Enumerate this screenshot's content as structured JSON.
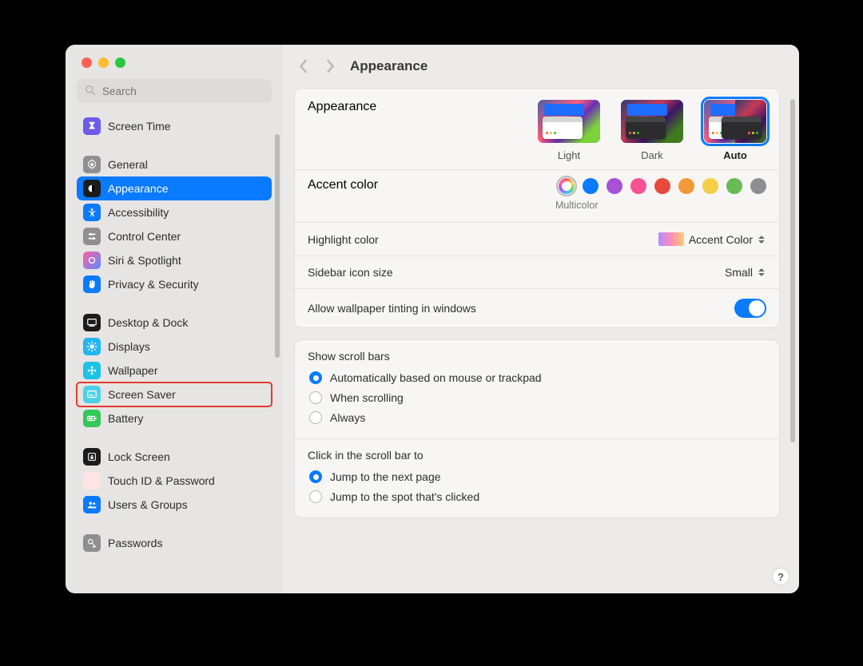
{
  "page_title": "Appearance",
  "search": {
    "placeholder": "Search"
  },
  "sidebar": {
    "items": [
      {
        "label": "Screen Time",
        "icon": "screentime"
      },
      {
        "label": "General",
        "icon": "general"
      },
      {
        "label": "Appearance",
        "icon": "appearance",
        "selected": true
      },
      {
        "label": "Accessibility",
        "icon": "accessibility"
      },
      {
        "label": "Control Center",
        "icon": "controlcenter"
      },
      {
        "label": "Siri & Spotlight",
        "icon": "siri"
      },
      {
        "label": "Privacy & Security",
        "icon": "privacy"
      },
      {
        "label": "Desktop & Dock",
        "icon": "desktop"
      },
      {
        "label": "Displays",
        "icon": "displays"
      },
      {
        "label": "Wallpaper",
        "icon": "wallpaper"
      },
      {
        "label": "Screen Saver",
        "icon": "screensaver",
        "highlighted": true
      },
      {
        "label": "Battery",
        "icon": "battery"
      },
      {
        "label": "Lock Screen",
        "icon": "lockscreen"
      },
      {
        "label": "Touch ID & Password",
        "icon": "touchid"
      },
      {
        "label": "Users & Groups",
        "icon": "users"
      },
      {
        "label": "Passwords",
        "icon": "passwords"
      }
    ]
  },
  "appearance": {
    "label": "Appearance",
    "options": {
      "light": "Light",
      "dark": "Dark",
      "auto": "Auto"
    },
    "selected": "Auto"
  },
  "accent": {
    "label": "Accent color",
    "multicolor_label": "Multicolor",
    "colors": [
      "multicolor",
      "#0a7aff",
      "#a751d8",
      "#f55193",
      "#e8493b",
      "#f19a37",
      "#f6cd46",
      "#68bb55",
      "#8e8e93"
    ],
    "selected": "multicolor"
  },
  "highlight": {
    "label": "Highlight color",
    "value": "Accent Color"
  },
  "sidebar_icon": {
    "label": "Sidebar icon size",
    "value": "Small"
  },
  "tinting": {
    "label": "Allow wallpaper tinting in windows",
    "on": true
  },
  "scrollbars": {
    "title": "Show scroll bars",
    "options": [
      "Automatically based on mouse or trackpad",
      "When scrolling",
      "Always"
    ],
    "selected": 0
  },
  "scroll_click": {
    "title": "Click in the scroll bar to",
    "options": [
      "Jump to the next page",
      "Jump to the spot that's clicked"
    ],
    "selected": 0
  },
  "help": "?"
}
